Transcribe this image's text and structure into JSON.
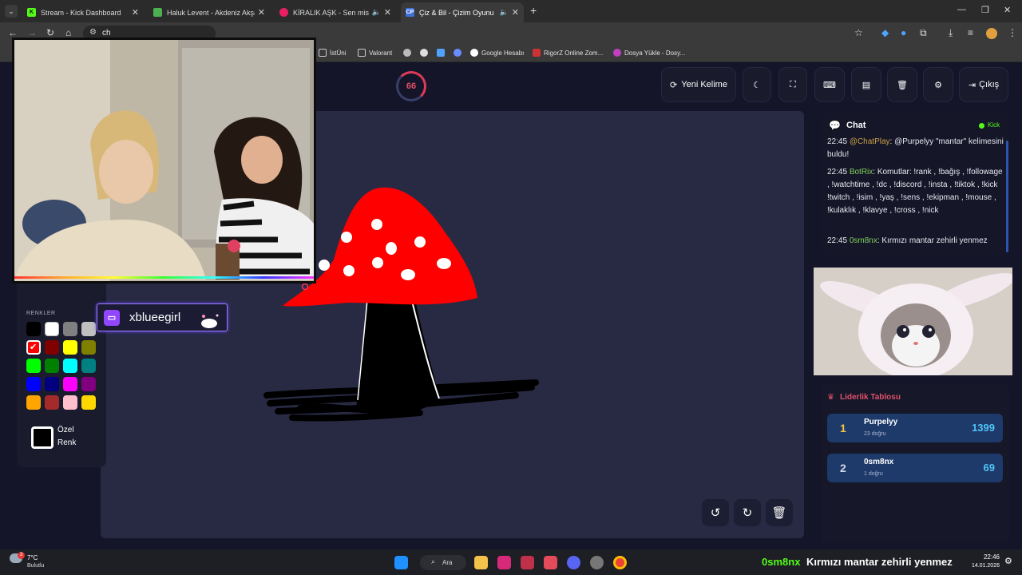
{
  "browser": {
    "tabs": [
      {
        "title": "Stream - Kick Dashboard",
        "active": false,
        "audio": false
      },
      {
        "title": "Haluk Levent - Akdeniz Akşamları",
        "active": false,
        "audio": false
      },
      {
        "title": "KİRALIK AŞK - Sen misin İlayda?",
        "active": false,
        "audio": true
      },
      {
        "title": "Çiz & Bil - Çizim Oyunu",
        "active": true,
        "audio": true
      }
    ],
    "tab_icon_cp": "CP",
    "new_tab": "+",
    "address_fragment": "ch",
    "bookmarks": [
      "İstÜni",
      "Valorant",
      "Google Hesabı",
      "RigorZ Online Zom...",
      "Dosya Yükle - Dosy..."
    ]
  },
  "game": {
    "timer": "66",
    "buttons": {
      "new_word": "Yeni Kelime",
      "logout": "Çıkış"
    },
    "palette": {
      "colors_label": "RENKLER",
      "swatches": [
        "#000000",
        "#ffffff",
        "#808080",
        "#c0c0c0",
        "#ff0000",
        "#800000",
        "#ffff00",
        "#808000",
        "#00ff00",
        "#008000",
        "#00ffff",
        "#008080",
        "#0000ff",
        "#000080",
        "#ff00ff",
        "#800080",
        "#ffa500",
        "#a52a2a",
        "#ffc0cb",
        "#ffd700"
      ],
      "custom_line1": "Özel",
      "custom_line2": "Renk"
    }
  },
  "overlay": {
    "streamer_name": "xblueegirl"
  },
  "chat": {
    "title": "Chat",
    "platform": "Kick",
    "messages": [
      {
        "time": "22:45",
        "user": "@ChatPlay",
        "text": ": @Purpelyy \"mantar\" kelimesini buldu!",
        "color": "#c9a24a"
      },
      {
        "time": "22:45",
        "user": "BotRix",
        "text": ": Komutlar: !rank , !bağış , !followage , !watchtime , !dc , !discord , !insta , !tiktok , !kick !twitch , !isim , !yaş , !sens , !ekipman , !mouse , !kulaklık , !klavye , !cross , !nick",
        "color": "#7fd35a"
      },
      {
        "time": "22:45",
        "user": "0sm8nx",
        "text": ": Kırmızı mantar zehirli yenmez",
        "color": "#7fd35a"
      }
    ]
  },
  "leaderboard": {
    "title": "Liderlik Tablosu",
    "rows": [
      {
        "rank": "1",
        "name": "Purpelyy",
        "sub": "23 doğru",
        "score": "1399"
      },
      {
        "rank": "2",
        "name": "0sm8nx",
        "sub": "1 doğru",
        "score": "69"
      }
    ]
  },
  "ticker": {
    "user": "0sm8nx",
    "text": "Kırmızı mantar zehirli yenmez"
  },
  "taskbar": {
    "weather_temp": "7°C",
    "weather_desc": "Bulutlu",
    "notif_badge": "3",
    "search_label": "Ara",
    "time": "22:46",
    "date": "14.01.2026"
  },
  "colors": {
    "accent_red": "#e0506a",
    "leader_blue": "#1e3a6a",
    "score_cyan": "#4fc3f7",
    "gold": "#f4c542"
  }
}
